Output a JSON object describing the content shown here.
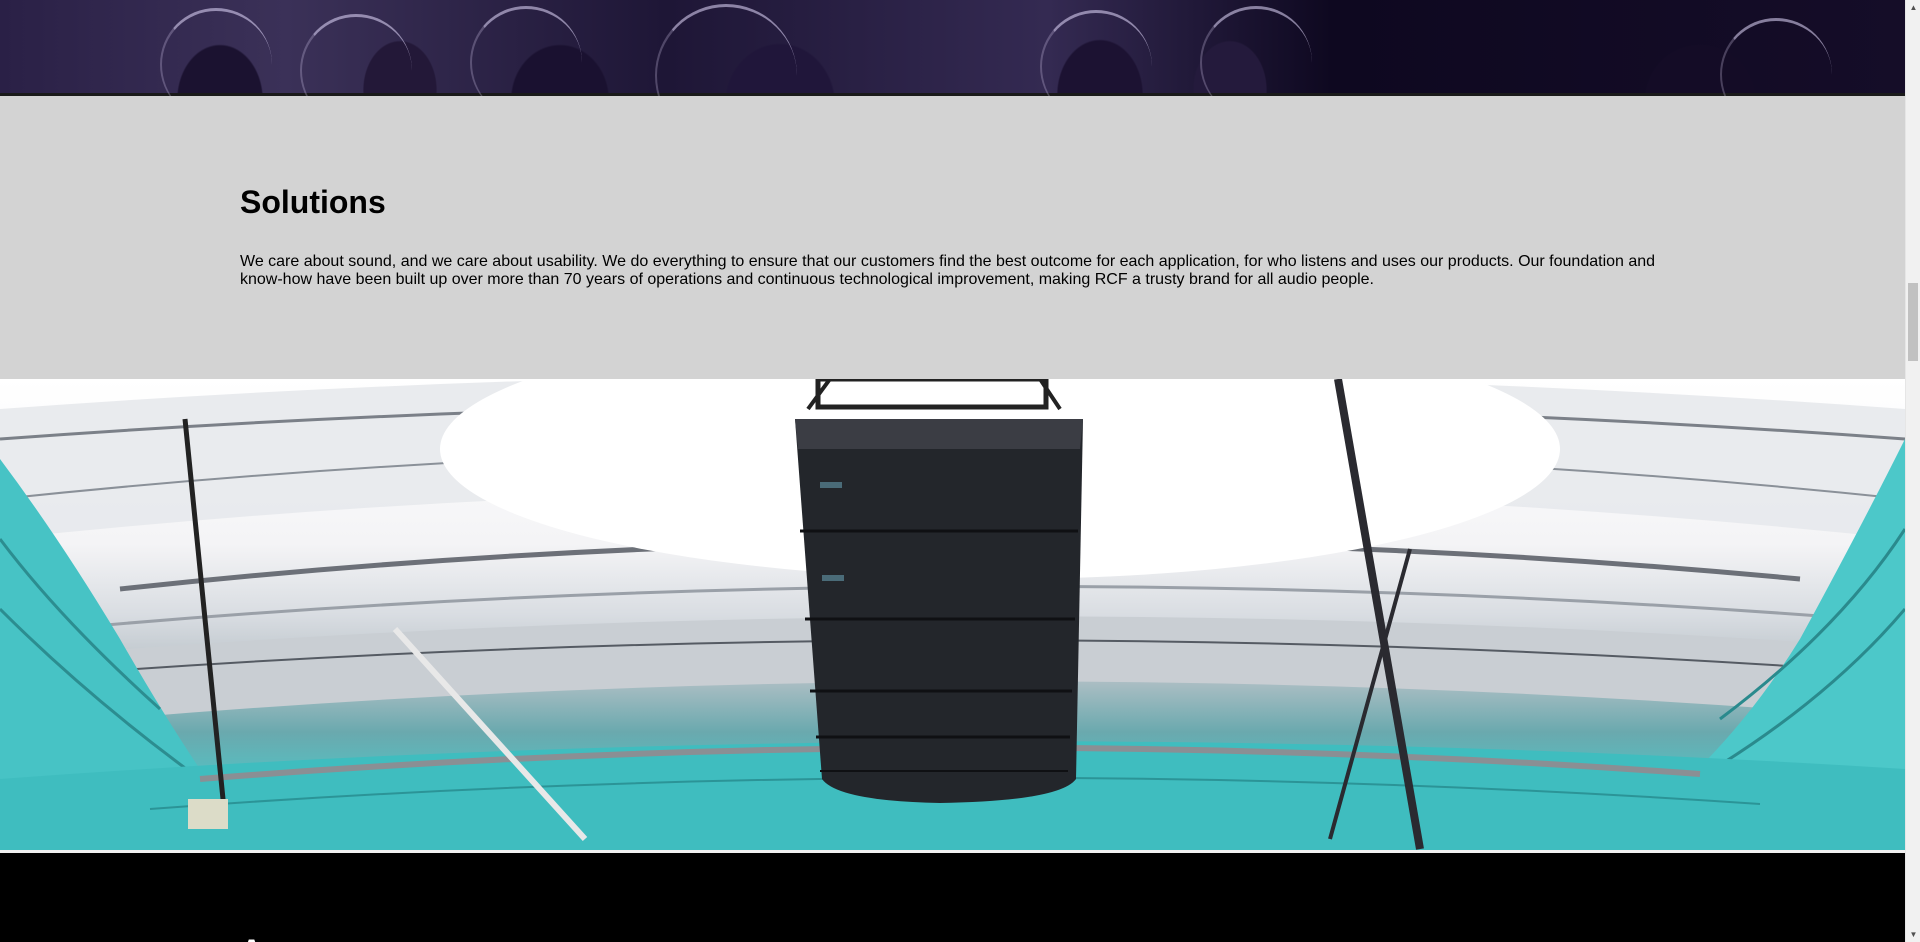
{
  "solutions": {
    "title": "Solutions",
    "text": "We care about sound, and we care about usability. We do everything to ensure that our customers find the best outcome for each application, for who listens and uses our products. Our foundation and know-how have been built up over more than 70 years of operations and continuous technological improvement, making RCF a trusty brand for all audio people."
  },
  "bottom": {
    "title": "Ap"
  },
  "images": {
    "hero": "concert-crowd-photo",
    "stadium": "stadium-line-array-photo"
  },
  "scrollbar": {
    "up_icon": "arrow-up-icon",
    "down_icon": "arrow-down-icon"
  },
  "colors": {
    "section_bg": "#d3d3d3",
    "bottom_bg": "#000000",
    "seat_teal": "#3fc6c6"
  }
}
